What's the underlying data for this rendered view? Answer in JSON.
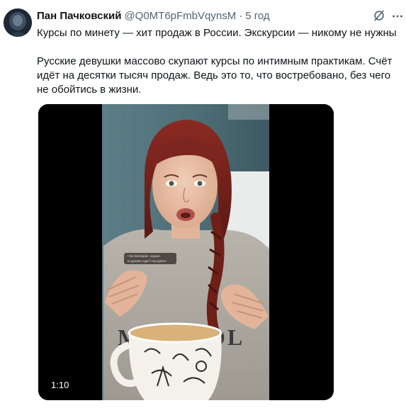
{
  "tweet": {
    "author": {
      "display_name": "Пан Пачковский",
      "handle": "@Q0MT6pFmbVqynsM",
      "separator": "·",
      "time": "5 год"
    },
    "icons": {
      "grok": "grok-icon",
      "more": "more-icon",
      "avatar": "avatar"
    },
    "text": {
      "paragraph_1": "Курсы по минету — хит продаж в России. Экскурсии — никому не нужны",
      "paragraph_2": "Русские девушки массово скупают курсы по интимным практикам. Счёт идёт на десятки тысяч продаж. Ведь это то, что востребовано, без чего не обойтись в жизни."
    },
    "media": {
      "type": "video",
      "duration": "1:10",
      "caption_line_1": "• 56 блогеров: «нужно",
      "caption_line_2": "в сделать курс? На курсе»",
      "sweater_text": "MIRÁCOL"
    }
  }
}
